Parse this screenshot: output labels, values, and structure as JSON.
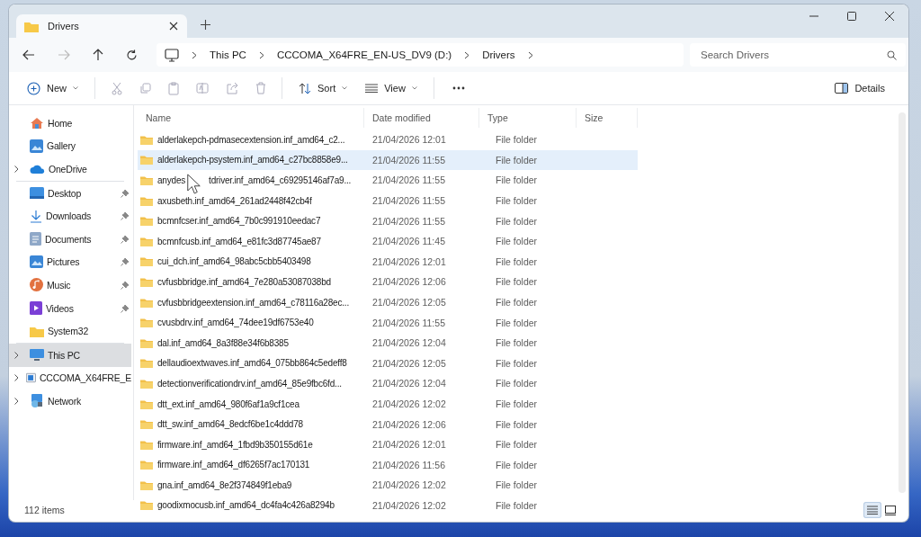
{
  "tab": {
    "title": "Drivers",
    "selected": true
  },
  "navigation": {
    "back_disabled": false,
    "forward_disabled": true
  },
  "breadcrumb": [
    "This PC",
    "CCCOMA_X64FRE_EN-US_DV9 (D:)",
    "Drivers"
  ],
  "search": {
    "placeholder": "Search Drivers"
  },
  "toolbar": {
    "new": "New",
    "sort": "Sort",
    "view": "View",
    "details": "Details"
  },
  "sidebar": [
    {
      "label": "Home",
      "kind": "home",
      "expandable": false,
      "pinned": false,
      "selected": false,
      "group_end": false
    },
    {
      "label": "Gallery",
      "kind": "gallery",
      "expandable": false,
      "pinned": false,
      "selected": false,
      "group_end": false
    },
    {
      "label": "OneDrive",
      "kind": "cloud",
      "expandable": true,
      "pinned": false,
      "selected": false,
      "group_end": true
    },
    {
      "label": "Desktop",
      "kind": "desktop",
      "expandable": false,
      "pinned": true,
      "selected": false,
      "group_end": false
    },
    {
      "label": "Downloads",
      "kind": "downloads",
      "expandable": false,
      "pinned": true,
      "selected": false,
      "group_end": false
    },
    {
      "label": "Documents",
      "kind": "documents",
      "expandable": false,
      "pinned": true,
      "selected": false,
      "group_end": false
    },
    {
      "label": "Pictures",
      "kind": "pictures",
      "expandable": false,
      "pinned": true,
      "selected": false,
      "group_end": false
    },
    {
      "label": "Music",
      "kind": "music",
      "expandable": false,
      "pinned": true,
      "selected": false,
      "group_end": false
    },
    {
      "label": "Videos",
      "kind": "videos",
      "expandable": false,
      "pinned": true,
      "selected": false,
      "group_end": false
    },
    {
      "label": "System32",
      "kind": "folder",
      "expandable": false,
      "pinned": false,
      "selected": false,
      "group_end": true
    },
    {
      "label": "This PC",
      "kind": "pc",
      "expandable": true,
      "pinned": false,
      "selected": true,
      "group_end": false
    },
    {
      "label": "CCCOMA_X64FRE_E",
      "kind": "drive",
      "expandable": true,
      "pinned": false,
      "selected": false,
      "group_end": false
    },
    {
      "label": "Network",
      "kind": "network",
      "expandable": true,
      "pinned": false,
      "selected": false,
      "group_end": false
    }
  ],
  "columns": [
    "Name",
    "Date modified",
    "Type",
    "Size"
  ],
  "rows": [
    {
      "name": "alderlakepch-pdmasecextension.inf_amd64_c2...",
      "date": "21/04/2026 12:01",
      "type": "File folder",
      "selected": false
    },
    {
      "name": "alderlakepch-psystem.inf_amd64_c27bc8858e9...",
      "date": "21/04/2026 11:55",
      "type": "File folder",
      "selected": true
    },
    {
      "name_parts": [
        "anydes",
        "tdriver.inf_amd64_c69295146af7a9..."
      ],
      "date": "21/04/2026 11:55",
      "type": "File folder",
      "selected": false
    },
    {
      "name": "axusbeth.inf_amd64_261ad2448f42cb4f",
      "date": "21/04/2026 11:55",
      "type": "File folder",
      "selected": false
    },
    {
      "name": "bcmnfcser.inf_amd64_7b0c991910eedac7",
      "date": "21/04/2026 11:55",
      "type": "File folder",
      "selected": false
    },
    {
      "name": "bcmnfcusb.inf_amd64_e81fc3d87745ae87",
      "date": "21/04/2026 11:45",
      "type": "File folder",
      "selected": false
    },
    {
      "name": "cui_dch.inf_amd64_98abc5cbb5403498",
      "date": "21/04/2026 12:01",
      "type": "File folder",
      "selected": false
    },
    {
      "name": "cvfusbbridge.inf_amd64_7e280a53087038bd",
      "date": "21/04/2026 12:06",
      "type": "File folder",
      "selected": false
    },
    {
      "name": "cvfusbbridgeextension.inf_amd64_c78116a28ec...",
      "date": "21/04/2026 12:05",
      "type": "File folder",
      "selected": false
    },
    {
      "name": "cvusbdrv.inf_amd64_74dee19df6753e40",
      "date": "21/04/2026 11:55",
      "type": "File folder",
      "selected": false
    },
    {
      "name": "dal.inf_amd64_8a3f88e34f6b8385",
      "date": "21/04/2026 12:04",
      "type": "File folder",
      "selected": false
    },
    {
      "name": "dellaudioextwaves.inf_amd64_075bb864c5edeff8",
      "date": "21/04/2026 12:05",
      "type": "File folder",
      "selected": false
    },
    {
      "name": "detectionverificationdrv.inf_amd64_85e9fbc6fd...",
      "date": "21/04/2026 12:04",
      "type": "File folder",
      "selected": false
    },
    {
      "name": "dtt_ext.inf_amd64_980f6af1a9cf1cea",
      "date": "21/04/2026 12:02",
      "type": "File folder",
      "selected": false
    },
    {
      "name": "dtt_sw.inf_amd64_8edcf6be1c4ddd78",
      "date": "21/04/2026 12:06",
      "type": "File folder",
      "selected": false
    },
    {
      "name": "firmware.inf_amd64_1fbd9b350155d61e",
      "date": "21/04/2026 12:01",
      "type": "File folder",
      "selected": false
    },
    {
      "name": "firmware.inf_amd64_df6265f7ac170131",
      "date": "21/04/2026 11:56",
      "type": "File folder",
      "selected": false
    },
    {
      "name": "gna.inf_amd64_8e2f374849f1eba9",
      "date": "21/04/2026 12:02",
      "type": "File folder",
      "selected": false
    },
    {
      "name": "goodixmocusb.inf_amd64_dc4fa4c426a8294b",
      "date": "21/04/2026 12:02",
      "type": "File folder",
      "selected": false
    }
  ],
  "status_bar": {
    "count": "112 items",
    "view_modes": [
      {
        "kind": "details",
        "selected": true
      },
      {
        "kind": "tiles",
        "selected": false
      }
    ]
  }
}
